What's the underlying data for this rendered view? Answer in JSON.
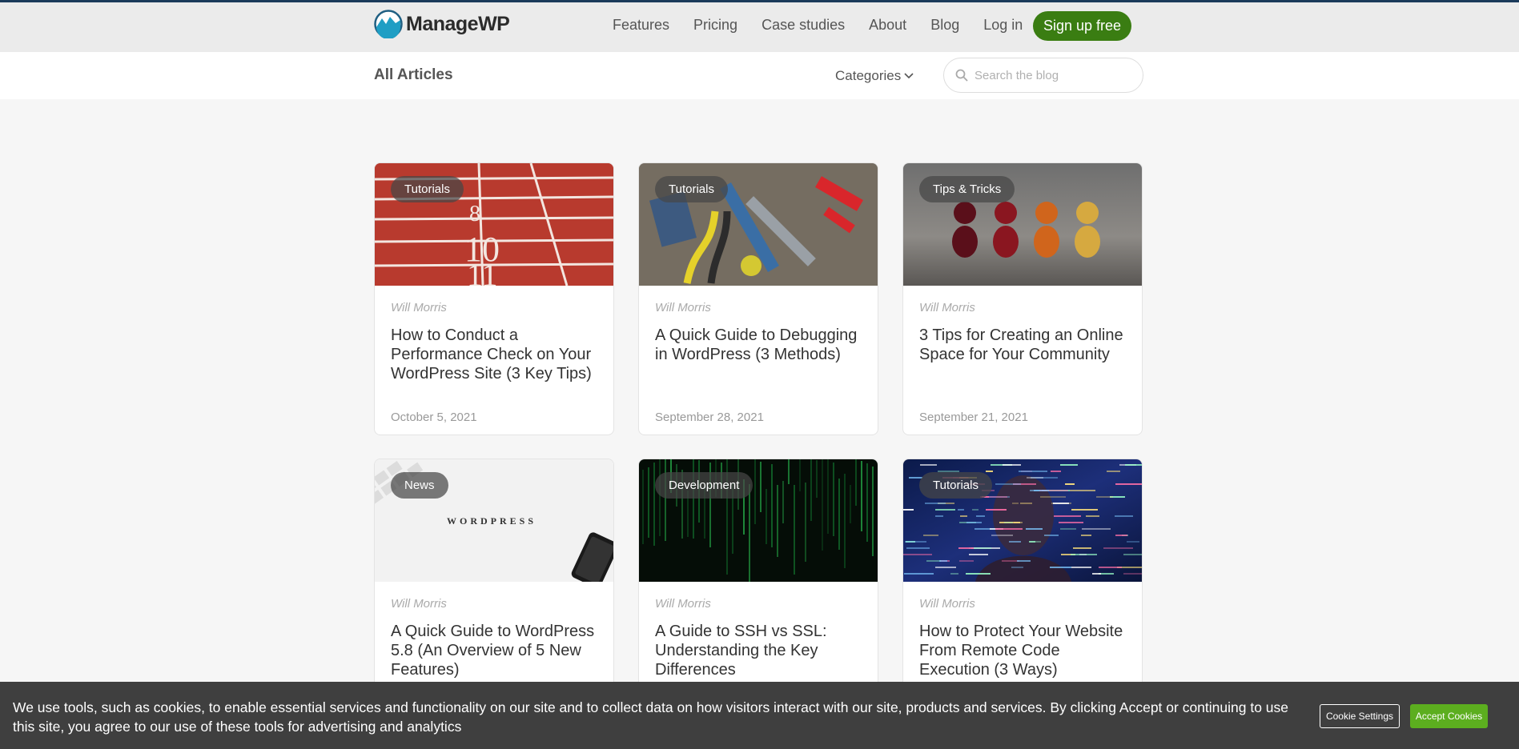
{
  "brand": {
    "name": "ManageWP",
    "accent": "#3a7d12"
  },
  "nav": {
    "items": [
      "Features",
      "Pricing",
      "Case studies",
      "About",
      "Blog",
      "Log in"
    ],
    "signup_label": "Sign up free"
  },
  "subbar": {
    "title": "All Articles",
    "categories_label": "Categories",
    "search_placeholder": "Search the blog"
  },
  "articles": [
    {
      "tag": "Tutorials",
      "author": "Will Morris",
      "title": "How to Conduct a Performance Check on Your WordPress Site (3 Key Tips)",
      "date": "October 5, 2021"
    },
    {
      "tag": "Tutorials",
      "author": "Will Morris",
      "title": "A Quick Guide to Debugging in WordPress (3 Methods)",
      "date": "September 28, 2021"
    },
    {
      "tag": "Tips & Tricks",
      "author": "Will Morris",
      "title": "3 Tips for Creating an Online Space for Your Community",
      "date": "September 21, 2021"
    },
    {
      "tag": "News",
      "author": "Will Morris",
      "title": "A Quick Guide to WordPress 5.8 (An Overview of 5 New Features)",
      "date": "",
      "image_text": "WORDPRESS"
    },
    {
      "tag": "Development",
      "author": "Will Morris",
      "title": "A Guide to SSH vs SSL: Understanding the Key Differences",
      "date": ""
    },
    {
      "tag": "Tutorials",
      "author": "Will Morris",
      "title": "How to Protect Your Website From Remote Code Execution (3 Ways)",
      "date": ""
    }
  ],
  "cookie": {
    "text": "We use tools, such as cookies, to enable essential services and functionality on our site and to collect data on how visitors interact with our site, products and services. By clicking Accept or continuing to use this site, you agree to our use of these tools for advertising and analytics",
    "settings_label": "Cookie Settings",
    "accept_label": "Accept Cookies"
  }
}
